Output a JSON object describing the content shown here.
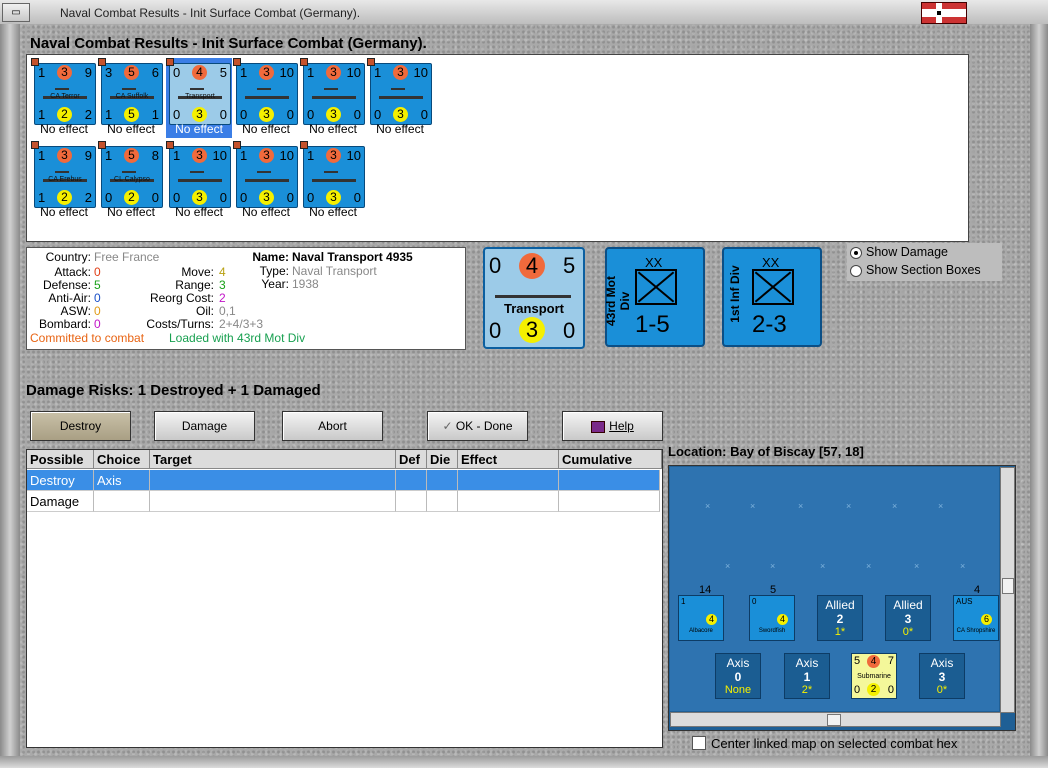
{
  "window": {
    "title": "Naval Combat Results - Init Surface Combat (Germany).",
    "heading": "Naval Combat Results - Init Surface Combat (Germany)."
  },
  "units": [
    {
      "tl": "1",
      "mid": "3",
      "tr": "9",
      "name": "CA Terror",
      "bl": "1",
      "bot": "2",
      "br": "2",
      "effect": "No effect",
      "selected": false
    },
    {
      "tl": "3",
      "mid": "5",
      "tr": "6",
      "name": "CA Suffolk",
      "bl": "1",
      "bot": "5",
      "br": "1",
      "effect": "No effect",
      "selected": false
    },
    {
      "tl": "0",
      "mid": "4",
      "tr": "5",
      "name": "Transport",
      "bl": "0",
      "bot": "3",
      "br": "0",
      "effect": "No effect",
      "selected": true
    },
    {
      "tl": "1",
      "mid": "3",
      "tr": "10",
      "name": "",
      "bl": "0",
      "bot": "3",
      "br": "0",
      "effect": "No effect",
      "selected": false
    },
    {
      "tl": "1",
      "mid": "3",
      "tr": "10",
      "name": "",
      "bl": "0",
      "bot": "3",
      "br": "0",
      "effect": "No effect",
      "selected": false
    },
    {
      "tl": "1",
      "mid": "3",
      "tr": "10",
      "name": "",
      "bl": "0",
      "bot": "3",
      "br": "0",
      "effect": "No effect",
      "selected": false
    },
    {
      "tl": "1",
      "mid": "3",
      "tr": "9",
      "name": "CA Erebus",
      "bl": "1",
      "bot": "2",
      "br": "2",
      "effect": "No effect",
      "selected": false
    },
    {
      "tl": "1",
      "mid": "5",
      "tr": "8",
      "name": "CL Calypso",
      "bl": "0",
      "bot": "2",
      "br": "0",
      "effect": "No effect",
      "selected": false
    },
    {
      "tl": "1",
      "mid": "3",
      "tr": "10",
      "name": "",
      "bl": "0",
      "bot": "3",
      "br": "0",
      "effect": "No effect",
      "selected": false
    },
    {
      "tl": "1",
      "mid": "3",
      "tr": "10",
      "name": "",
      "bl": "0",
      "bot": "3",
      "br": "0",
      "effect": "No effect",
      "selected": false
    },
    {
      "tl": "1",
      "mid": "3",
      "tr": "10",
      "name": "",
      "bl": "0",
      "bot": "3",
      "br": "0",
      "effect": "No effect",
      "selected": false
    }
  ],
  "info": {
    "country_label": "Country:",
    "country": "Free France",
    "attack_label": "Attack:",
    "attack": "0",
    "defense_label": "Defense:",
    "defense": "5",
    "antiair_label": "Anti-Air:",
    "antiair": "0",
    "asw_label": "ASW:",
    "asw": "0",
    "bombard_label": "Bombard:",
    "bombard": "0",
    "move_label": "Move:",
    "move": "4",
    "range_label": "Range:",
    "range": "3",
    "reorg_label": "Reorg Cost:",
    "reorg": "2",
    "oil_label": "Oil:",
    "oil": "0,1",
    "costs_label": "Costs/Turns:",
    "costs": "2+4/3+3",
    "name_label": "Name:",
    "name": "Naval Transport 4935",
    "type_label": "Type:",
    "type": "Naval Transport",
    "year_label": "Year:",
    "year": "1938",
    "committed": "Committed to combat",
    "loaded": "Loaded with 43rd Mot Div"
  },
  "big_counter": {
    "tl": "0",
    "mid": "4",
    "tr": "5",
    "name": "Transport",
    "bl": "0",
    "bot": "3",
    "br": "0"
  },
  "divisions": [
    {
      "size": "XX",
      "name": "43rd Mot Div",
      "strength": "1-5"
    },
    {
      "size": "XX",
      "name": "1st Inf Div",
      "strength": "2-3"
    }
  ],
  "radios": {
    "show_damage": "Show Damage",
    "show_sections": "Show Section Boxes"
  },
  "damage_risks": "Damage Risks: 1 Destroyed + 1 Damaged",
  "buttons": {
    "destroy": "Destroy",
    "damage": "Damage",
    "abort": "Abort",
    "ok": "OK - Done",
    "help": "Help"
  },
  "table": {
    "headers": [
      "Possible",
      "Choice",
      "Target",
      "Def",
      "Die",
      "Effect",
      "Cumulative"
    ],
    "rows": [
      [
        "Destroy",
        "Axis",
        "",
        "",
        "",
        "",
        ""
      ],
      [
        "Damage",
        "",
        "",
        "",
        "",
        "",
        ""
      ]
    ]
  },
  "location": "Location:  Bay of Biscay [57, 18]",
  "map": {
    "counters": [
      {
        "kind": "blue",
        "top": "14",
        "label": "Albacore",
        "tl": "1",
        "circ": "4"
      },
      {
        "kind": "blue",
        "top": "5",
        "label": "Swordfish",
        "tl": "0",
        "circ": "4"
      },
      {
        "kind": "dark",
        "side": "Allied",
        "num": "2",
        "sub": "1*"
      },
      {
        "kind": "dark",
        "side": "Allied",
        "num": "3",
        "sub": "0*"
      },
      {
        "kind": "blue",
        "top": "4",
        "label": "CA Shropshire",
        "tl": "AUS",
        "circ": "6"
      }
    ],
    "axis_counters": [
      {
        "side": "Axis",
        "num": "0",
        "sub": "None"
      },
      {
        "side": "Axis",
        "num": "1",
        "sub": "2*"
      },
      {
        "side": "Submarine",
        "tl": "5",
        "mid": "4",
        "tr": "7",
        "bl": "0",
        "bot": "2",
        "br": "0"
      },
      {
        "side": "Axis",
        "num": "3",
        "sub": "0*"
      }
    ]
  },
  "center_linked": "Center linked map on selected combat hex"
}
